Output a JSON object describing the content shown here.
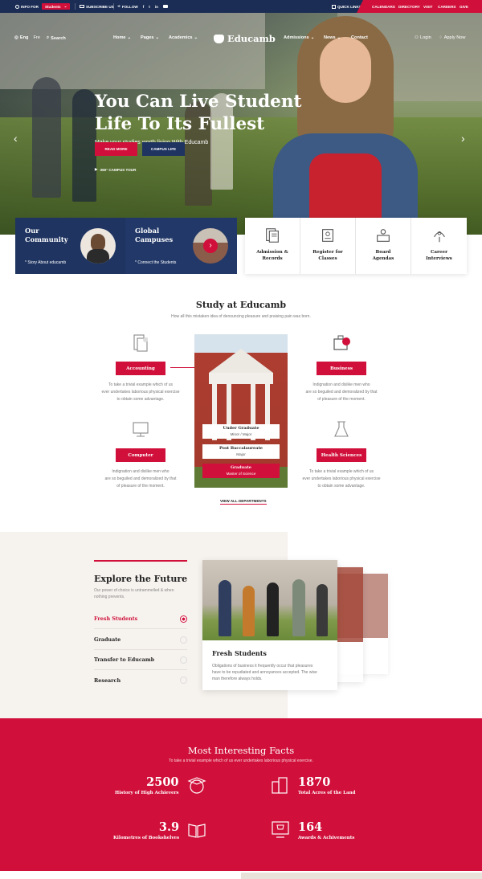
{
  "topbar": {
    "info_label": "INFO FOR",
    "info_select": "Students",
    "subscribe": "SUBSCRIBE US",
    "follow": "FOLLOW",
    "quick_links": "QUICK LINKS",
    "links": [
      "CALENDARS",
      "DIRECTORY",
      "VISIT",
      "CAREERS",
      "GIVE"
    ]
  },
  "nav": {
    "lang1": "Eng",
    "lang2": "Fre",
    "search": "Search",
    "menu": [
      "Home",
      "Pages",
      "Academics",
      "Admissions",
      "News",
      "Contact"
    ],
    "logo": "Educamb",
    "login": "Login",
    "apply": "Apply Now"
  },
  "hero": {
    "title_line1": "You Can Live Student",
    "title_line2": "Life To Its Fullest",
    "subtitle": "Make your studies worth living With Educamb",
    "btn_read": "READ MORE",
    "btn_campus": "CAMPUS LIFE",
    "tour": "360° CAMPUS TOUR"
  },
  "features": [
    {
      "title1": "Our",
      "title2": "Community",
      "link": "Story About educamb"
    },
    {
      "title1": "Global",
      "title2": "Campuses",
      "link": "Connect the Students"
    }
  ],
  "quicklinks": [
    {
      "l1": "Admission &",
      "l2": "Records",
      "icon": "documents-icon"
    },
    {
      "l1": "Register for",
      "l2": "Classes",
      "icon": "register-icon"
    },
    {
      "l1": "Board",
      "l2": "Agendas",
      "icon": "board-icon"
    },
    {
      "l1": "Career",
      "l2": "Interviews",
      "icon": "career-icon"
    }
  ],
  "study": {
    "title": "Study at Educamb",
    "subtitle": "How all this mistaken idea of denouncing pleasure and praising pain was born.",
    "depts": [
      {
        "name": "Accounting",
        "text1": "To take a trivial example which of us",
        "text2": "ever undertakes laborious physical exercise",
        "text3": "to obtain some advantage."
      },
      {
        "name": "Business",
        "text1": "Indignation and dislike men who",
        "text2": "are so beguiled and demoralized by that",
        "text3": "of pleasure of the moment."
      },
      {
        "name": "Computer",
        "text1": "Indignation and dislike men who",
        "text2": "are so beguiled and demoralized by that",
        "text3": "of pleasure of the moment."
      },
      {
        "name": "Health Sciences",
        "text1": "To take a trivial example which of us",
        "text2": "ever undertakes laborious physical exercise",
        "text3": "to obtain some advantage."
      }
    ],
    "degrees": [
      {
        "t": "Under Graduate",
        "s": "Minor / Major"
      },
      {
        "t": "Post Baccalaureate",
        "s": "Major"
      },
      {
        "t": "Graduate",
        "s": "Master of Science"
      }
    ],
    "view_all": "VIEW ALL DEPARTMENTS"
  },
  "explore": {
    "title": "Explore the Future",
    "desc1": "Our power of choice is untrammelled & when",
    "desc2": "nothing prevents.",
    "items": [
      "Fresh Students",
      "Graduate",
      "Transfer to Educamb",
      "Research"
    ],
    "card_title": "Fresh Students",
    "card_text1": "Obligations of business it frequently occur that pleasures",
    "card_text2": "have to be repudiated and annoyances accepted. The wise",
    "card_text3": "man therefore always holds."
  },
  "facts": {
    "title": "Most Interesting Facts",
    "subtitle": "To take a trivial example which of us ever undertakes laborious physical exercise.",
    "items": [
      {
        "num": "2500",
        "label": "History of High Achievers"
      },
      {
        "num": "1870",
        "label": "Total Acres of the Land"
      },
      {
        "num": "3.9",
        "label": "Kilometres of Bookshelves"
      },
      {
        "num": "164",
        "label": "Awards & Achivements"
      }
    ]
  },
  "colors": {
    "brand_red": "#d0103a",
    "navy": "#1b2d54",
    "navy_card": "#1f3461"
  }
}
